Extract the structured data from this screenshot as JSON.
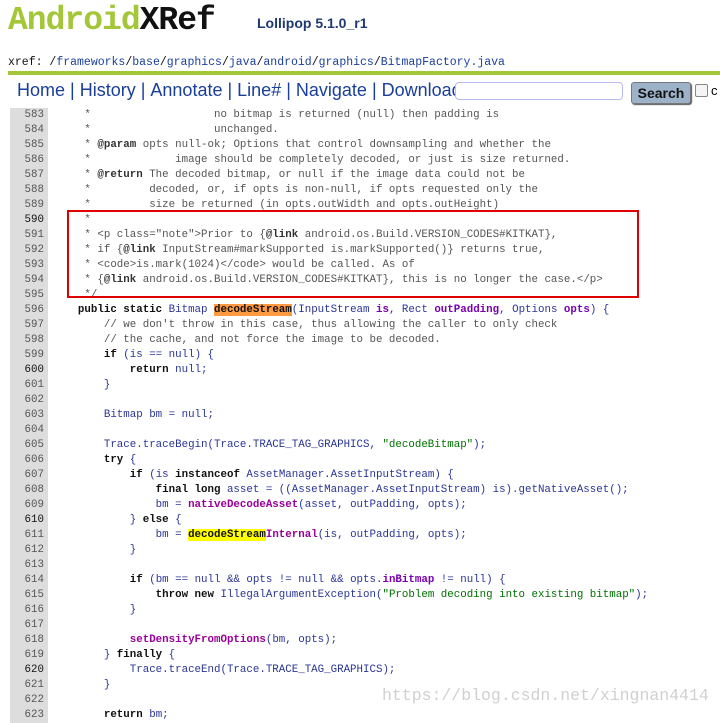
{
  "header": {
    "logo_part1": "Android",
    "logo_part2": "XRef",
    "version": "Lollipop 5.1.0_r1"
  },
  "breadcrumb": {
    "prefix": "xref: /",
    "parts": [
      "frameworks",
      "base",
      "graphics",
      "java",
      "android",
      "graphics",
      "BitmapFactory.java"
    ]
  },
  "nav": {
    "items": [
      "Home",
      "History",
      "Annotate",
      "Line#",
      "Navigate",
      "Download"
    ],
    "search_value": "",
    "search_button": "Search",
    "checkbox_label": "c"
  },
  "watermark": "https://blog.csdn.net/xingnan4414",
  "colors": {
    "brand": "#a4c639",
    "highlight_current": "#ff9a40",
    "highlight_match": "#ffff00",
    "annotation_box": "#e00000"
  },
  "code": [
    {
      "n": 583,
      "tok": [
        [
          "c",
          "     *                   no bitmap is returned (null) then padding is"
        ]
      ]
    },
    {
      "n": 584,
      "tok": [
        [
          "c",
          "     *                   unchanged."
        ]
      ]
    },
    {
      "n": 585,
      "tok": [
        [
          "c",
          "     * "
        ],
        [
          "d",
          "@param"
        ],
        [
          "c",
          " opts null-ok; Options that control downsampling and whether the"
        ]
      ]
    },
    {
      "n": 586,
      "tok": [
        [
          "c",
          "     *             image should be completely decoded, or just is size returned."
        ]
      ]
    },
    {
      "n": 587,
      "tok": [
        [
          "c",
          "     * "
        ],
        [
          "d",
          "@return"
        ],
        [
          "c",
          " The decoded bitmap, or null if the image data could not be"
        ]
      ]
    },
    {
      "n": 588,
      "tok": [
        [
          "c",
          "     *         decoded, or, if opts is non-null, if opts requested only the"
        ]
      ]
    },
    {
      "n": 589,
      "tok": [
        [
          "c",
          "     *         size be returned (in opts.outWidth and opts.outHeight)"
        ]
      ]
    },
    {
      "n": 590,
      "b": true,
      "tok": [
        [
          "c",
          "     *"
        ]
      ]
    },
    {
      "n": 591,
      "tok": [
        [
          "c",
          "     * <p class=\"note\">Prior to {"
        ],
        [
          "d",
          "@link"
        ],
        [
          "c",
          " android.os.Build.VERSION_CODES#KITKAT},"
        ]
      ]
    },
    {
      "n": 592,
      "tok": [
        [
          "c",
          "     * if {"
        ],
        [
          "d",
          "@link"
        ],
        [
          "c",
          " InputStream#markSupported is.markSupported()} returns true,"
        ]
      ]
    },
    {
      "n": 593,
      "tok": [
        [
          "c",
          "     * <code>is.mark(1024)</code> would be called. As of"
        ]
      ]
    },
    {
      "n": 594,
      "tok": [
        [
          "c",
          "     * {"
        ],
        [
          "d",
          "@link"
        ],
        [
          "c",
          " android.os.Build.VERSION_CODES#KITKAT}, this is no longer the case.</p>"
        ]
      ]
    },
    {
      "n": 595,
      "tok": [
        [
          "c",
          "     */"
        ]
      ]
    },
    {
      "n": 596,
      "tok": [
        [
          "",
          "    "
        ],
        [
          "k",
          "public static "
        ],
        [
          "t",
          "Bitmap "
        ],
        [
          "h1",
          "decodeStream"
        ],
        [
          "t",
          "(InputStream "
        ],
        [
          "v",
          "is"
        ],
        [
          "t",
          ", Rect "
        ],
        [
          "v",
          "outPadding"
        ],
        [
          "t",
          ", Options "
        ],
        [
          "v",
          "opts"
        ],
        [
          "t",
          ") {"
        ]
      ]
    },
    {
      "n": 597,
      "tok": [
        [
          "c",
          "        // we don't throw in this case, thus allowing the caller to only check"
        ]
      ]
    },
    {
      "n": 598,
      "tok": [
        [
          "c",
          "        // the cache, and not force the image to be decoded."
        ]
      ]
    },
    {
      "n": 599,
      "tok": [
        [
          "",
          "        "
        ],
        [
          "k",
          "if"
        ],
        [
          "t",
          " (is == null) {"
        ]
      ]
    },
    {
      "n": 600,
      "b": true,
      "tok": [
        [
          "",
          "            "
        ],
        [
          "k",
          "return"
        ],
        [
          "t",
          " null;"
        ]
      ]
    },
    {
      "n": 601,
      "tok": [
        [
          "t",
          "        }"
        ]
      ]
    },
    {
      "n": 602,
      "tok": []
    },
    {
      "n": 603,
      "tok": [
        [
          "t",
          "        Bitmap bm = null;"
        ]
      ]
    },
    {
      "n": 604,
      "tok": []
    },
    {
      "n": 605,
      "tok": [
        [
          "t",
          "        Trace.traceBegin(Trace.TRACE_TAG_GRAPHICS, "
        ],
        [
          "s",
          "\"decodeBitmap\""
        ],
        [
          "t",
          ");"
        ]
      ]
    },
    {
      "n": 606,
      "tok": [
        [
          "",
          "        "
        ],
        [
          "k",
          "try"
        ],
        [
          "t",
          " {"
        ]
      ]
    },
    {
      "n": 607,
      "tok": [
        [
          "",
          "            "
        ],
        [
          "k",
          "if"
        ],
        [
          "t",
          " (is "
        ],
        [
          "k",
          "instanceof"
        ],
        [
          "t",
          " AssetManager.AssetInputStream) {"
        ]
      ]
    },
    {
      "n": 608,
      "tok": [
        [
          "",
          "                "
        ],
        [
          "k",
          "final long"
        ],
        [
          "t",
          " asset = ((AssetManager.AssetInputStream) is).getNativeAsset();"
        ]
      ]
    },
    {
      "n": 609,
      "tok": [
        [
          "t",
          "                bm = "
        ],
        [
          "f",
          "nativeDecodeAsset"
        ],
        [
          "t",
          "(asset, outPadding, opts);"
        ]
      ]
    },
    {
      "n": 610,
      "b": true,
      "tok": [
        [
          "t",
          "            } "
        ],
        [
          "k",
          "else"
        ],
        [
          "t",
          " {"
        ]
      ]
    },
    {
      "n": 611,
      "tok": [
        [
          "t",
          "                bm = "
        ],
        [
          "h2",
          "decodeStream"
        ],
        [
          "f",
          "Internal"
        ],
        [
          "t",
          "(is, outPadding, opts);"
        ]
      ]
    },
    {
      "n": 612,
      "tok": [
        [
          "t",
          "            }"
        ]
      ]
    },
    {
      "n": 613,
      "tok": []
    },
    {
      "n": 614,
      "tok": [
        [
          "",
          "            "
        ],
        [
          "k",
          "if"
        ],
        [
          "t",
          " (bm == null && opts != null && opts."
        ],
        [
          "v",
          "inBitmap"
        ],
        [
          "t",
          " != null) {"
        ]
      ]
    },
    {
      "n": 615,
      "tok": [
        [
          "",
          "                "
        ],
        [
          "k",
          "throw new"
        ],
        [
          "t",
          " IllegalArgumentException("
        ],
        [
          "s",
          "\"Problem decoding into existing bitmap\""
        ],
        [
          "t",
          ");"
        ]
      ]
    },
    {
      "n": 616,
      "tok": [
        [
          "t",
          "            }"
        ]
      ]
    },
    {
      "n": 617,
      "tok": []
    },
    {
      "n": 618,
      "tok": [
        [
          "",
          "            "
        ],
        [
          "f",
          "setDensityFromOptions"
        ],
        [
          "t",
          "(bm, opts);"
        ]
      ]
    },
    {
      "n": 619,
      "tok": [
        [
          "t",
          "        } "
        ],
        [
          "k",
          "finally"
        ],
        [
          "t",
          " {"
        ]
      ]
    },
    {
      "n": 620,
      "b": true,
      "tok": [
        [
          "t",
          "            Trace.traceEnd(Trace.TRACE_TAG_GRAPHICS);"
        ]
      ]
    },
    {
      "n": 621,
      "tok": [
        [
          "t",
          "        }"
        ]
      ]
    },
    {
      "n": 622,
      "tok": []
    },
    {
      "n": 623,
      "tok": [
        [
          "",
          "        "
        ],
        [
          "k",
          "return"
        ],
        [
          "t",
          " bm;"
        ]
      ]
    }
  ]
}
